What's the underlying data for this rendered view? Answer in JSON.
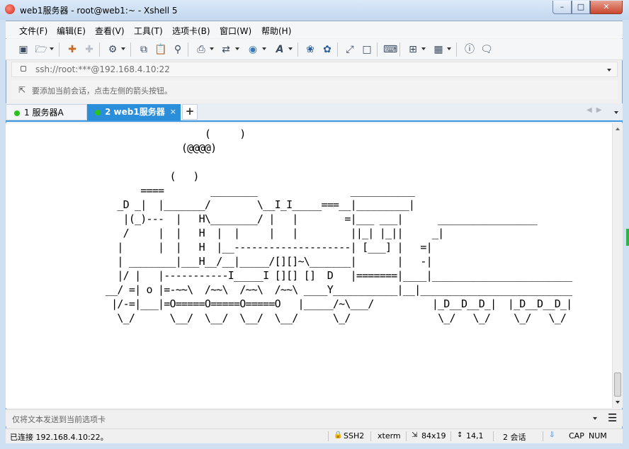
{
  "window": {
    "title": "web1服务器 - root@web1:~ - Xshell 5"
  },
  "menu": [
    "文件(F)",
    "编辑(E)",
    "查看(V)",
    "工具(T)",
    "选项卡(B)",
    "窗口(W)",
    "帮助(H)"
  ],
  "toolbar": {
    "icons": [
      "new-session-icon",
      "open-folder-icon",
      "reconnect-icon",
      "disconnect-icon",
      "properties-icon",
      "copy-icon",
      "paste-icon",
      "find-icon",
      "print-icon",
      "transfer-icon",
      "globe-icon",
      "font-icon",
      "xftp-icon",
      "xmanager-icon",
      "fullscreen-icon",
      "lock-icon",
      "keyboard-icon",
      "new-tab-icon",
      "layout-icon",
      "help-icon",
      "chat-icon"
    ]
  },
  "address": {
    "text": "ssh://root:***@192.168.4.10:22"
  },
  "hint": {
    "text": "要添加当前会话，点击左侧的箭头按钮。"
  },
  "tabs": [
    {
      "number": "1",
      "label": "1 服务器A",
      "active": false,
      "status_color": "#2bc11e"
    },
    {
      "number": "2",
      "label": "2 web1服务器",
      "active": true,
      "status_color": "#2bc11e",
      "close": "×"
    }
  ],
  "tab_add": "+",
  "terminal": {
    "lines": [
      "                                  (     )",
      "                              (@@@@)",
      "",
      "                            (   )",
      "                       ====        ________                ___________",
      "                   _D _|  |_______/        \\__I_I_____===__|_________|",
      "                    |(_)---  |   H\\________/ |   |        =|___ ___|      _________________",
      "                    /     |  |   H  |  |     |   |         ||_| |_||     _|",
      "                   |      |  |   H  |__--------------------| [___] |   =|",
      "                   | ________|___H__/__|_____/[][]~\\_______|       |   -|",
      "                   |/ |   |-----------I_____I [][] []  D   |=======|____|________________________",
      "                 __/ =| o |=-~~\\  /~~\\  /~~\\  /~~\\ ____Y___________|__|__________________________",
      "                  |/-=|___|=O=====O=====O=====O   |_____/~\\___/          |_D__D__D_|  |_D__D__D_|",
      "                   \\_/      \\__/  \\__/  \\__/  \\__/      \\_/               \\_/   \\_/    \\_/   \\_/"
    ]
  },
  "send_bar": {
    "placeholder": "仅将文本发送到当前选项卡"
  },
  "status": {
    "connection": "已连接 192.168.4.10:22。",
    "protocol": "SSH2",
    "terminal_type": "xterm",
    "size": "84x19",
    "cursor": "14,1",
    "sessions": "2 会话",
    "caps": "CAP",
    "num": "NUM"
  }
}
